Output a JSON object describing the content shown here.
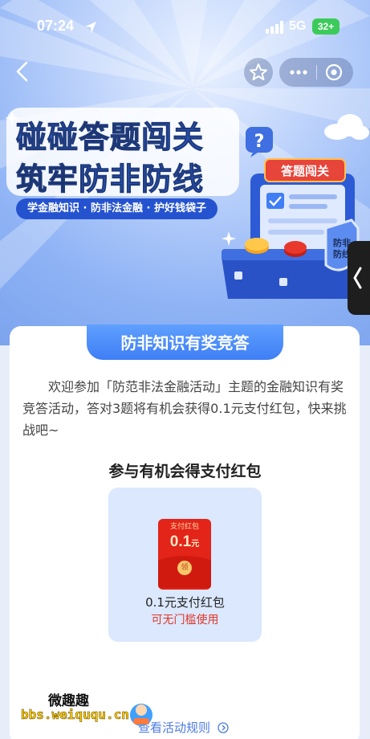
{
  "status_bar": {
    "time": "07:24",
    "network": "5G",
    "battery": "32+"
  },
  "hero": {
    "title_line1_a": "碰碰",
    "title_line1_b": "答题",
    "title_line1_c": "闯关",
    "title_line2_a": "筑牢",
    "title_line2_b": "防非防线",
    "subtitle": "学金融知识 · 防非法金融 · 护好钱袋子",
    "machine_sign": "答题闯关",
    "shield_text": "防非防线",
    "question_mark": "?"
  },
  "card": {
    "tab_title": "防非知识有奖竞答",
    "intro": "欢迎参加「防范非法金融活动」主题的金融知识有奖竞答活动，答对3题将有机会获得0.1元支付红包，快来挑战吧~",
    "section_title": "参与有机会得支付红包",
    "envelope_label": "支付红包",
    "envelope_amount": "0.1",
    "envelope_unit": "元",
    "envelope_coin": "领",
    "reward_name": "0.1元支付红包",
    "reward_note": "可无门槛使用"
  },
  "footer": {
    "rules_link": "查看活动规则",
    "watermark_title": "微趣趣",
    "watermark_url": "bbs.weiququ.cn"
  },
  "colors": {
    "primary": "#3f7ef5",
    "accent_red": "#e32419",
    "reward_bg": "#dbe8fd"
  },
  "icons": [
    "location-arrow-icon",
    "signal-icon",
    "back-icon",
    "star-icon",
    "more-icon",
    "target-icon",
    "chevron-right-icon"
  ]
}
